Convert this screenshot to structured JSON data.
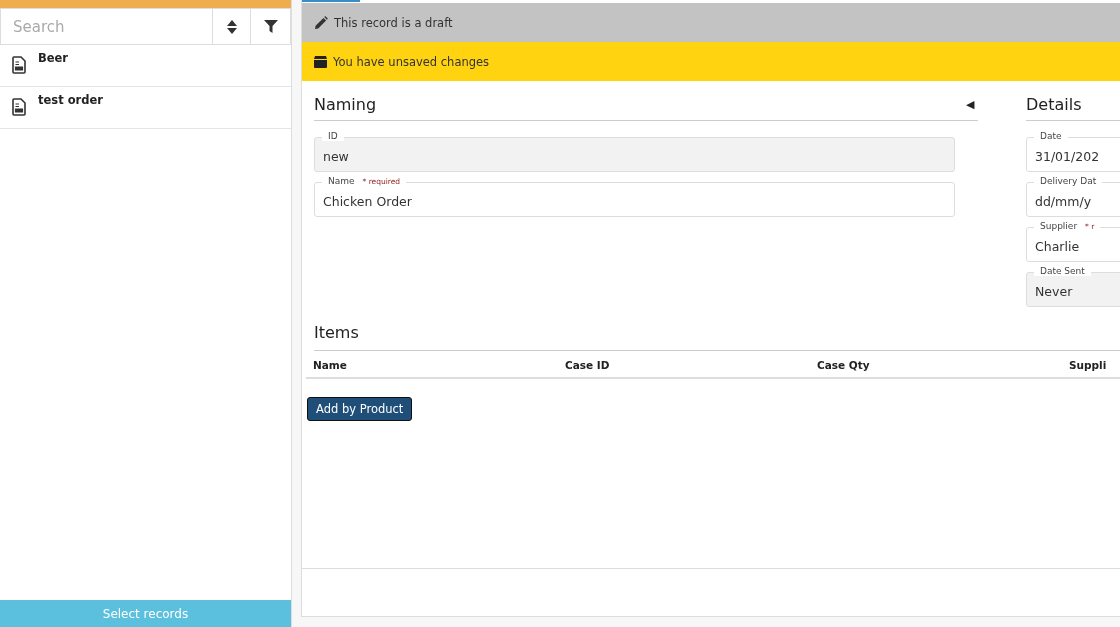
{
  "sidebar": {
    "search": {
      "placeholder": "Search"
    },
    "records": [
      {
        "name": "Beer"
      },
      {
        "name": "test order"
      }
    ],
    "select_button": "Select records"
  },
  "banners": [
    {
      "kind": "draft",
      "text": "This record is a draft"
    },
    {
      "kind": "unsaved",
      "text": "You have unsaved changes"
    }
  ],
  "naming": {
    "title": "Naming",
    "collapse_icon": "◀",
    "fields": [
      {
        "label": "ID",
        "value": "new",
        "disabled": true
      },
      {
        "label": "Name",
        "required_note": "* required",
        "value": "Chicken Order",
        "disabled": false
      }
    ]
  },
  "details": {
    "title": "Details",
    "fields": [
      {
        "label": "Date",
        "value": "31/01/202",
        "disabled": false
      },
      {
        "label": "Delivery Dat",
        "value": "dd/mm/y",
        "disabled": false
      },
      {
        "label": "Supplier",
        "required_note": "* r",
        "value": " Charlie",
        "disabled": false
      },
      {
        "label": "Date Sent",
        "value": "Never",
        "disabled": true
      }
    ]
  },
  "items": {
    "title": "Items",
    "columns": [
      "Name",
      "Case ID",
      "Case Qty",
      "Suppli"
    ],
    "add_button": "Add by Product"
  }
}
